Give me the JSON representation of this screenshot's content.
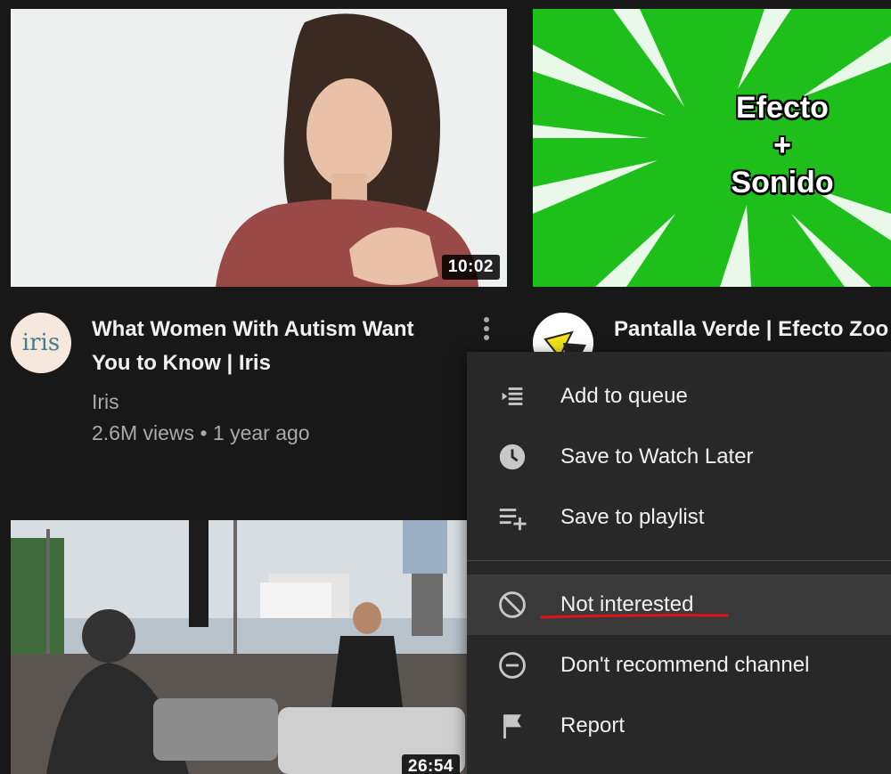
{
  "videos": [
    {
      "duration": "10:02",
      "title": "What Women With Autism Want You to Know | Iris",
      "channel": "Iris",
      "views": "2.6M views",
      "separator": "•",
      "age": "1 year ago",
      "avatar_text": "iris"
    },
    {
      "title": "Pantalla Verde | Efecto Zoo",
      "thumb_text_1": "Efecto",
      "thumb_text_2": "+",
      "thumb_text_3": "Sonido"
    },
    {
      "duration": "26:54"
    }
  ],
  "menu": {
    "items": [
      {
        "label": "Add to queue",
        "icon": "add-to-queue-icon"
      },
      {
        "label": "Save to Watch Later",
        "icon": "clock-icon"
      },
      {
        "label": "Save to playlist",
        "icon": "playlist-add-icon"
      },
      {
        "label": "Not interested",
        "icon": "block-icon"
      },
      {
        "label": "Don't recommend channel",
        "icon": "minus-circle-icon"
      },
      {
        "label": "Report",
        "icon": "flag-icon"
      }
    ]
  },
  "colors": {
    "background": "#181818",
    "menu_background": "#282828",
    "annotation": "#e0141c",
    "green_screen": "#1ebf1b"
  }
}
